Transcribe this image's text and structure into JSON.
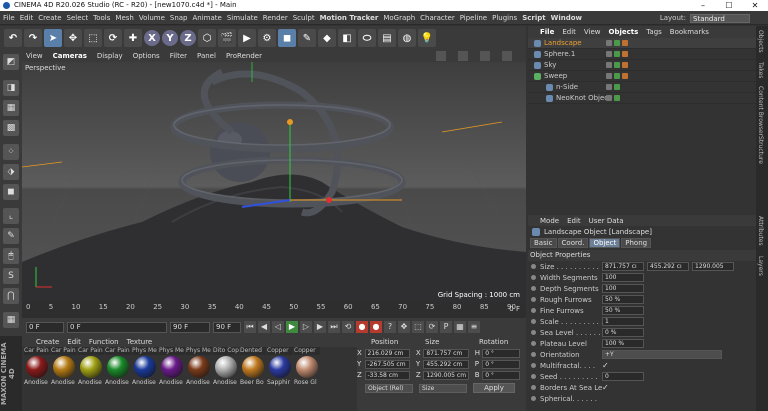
{
  "titlebar": {
    "title": "CINEMA 4D R20.026 Studio (RC - R20) - [new1070.c4d *] - Main"
  },
  "menubar": {
    "items": [
      "File",
      "Edit",
      "Create",
      "Select",
      "Tools",
      "Mesh",
      "Volume",
      "Snap",
      "Animate",
      "Simulate",
      "Render",
      "Sculpt",
      "Motion Tracker",
      "MoGraph",
      "Character",
      "Pipeline",
      "Plugins",
      "Script",
      "Window"
    ],
    "layout_label": "Layout:",
    "layout_value": "Standard"
  },
  "toolbar": {
    "axis_x": "X",
    "axis_y": "Y",
    "axis_z": "Z"
  },
  "viewport": {
    "menu": [
      "View",
      "Cameras",
      "Display",
      "Options",
      "Filter",
      "Panel",
      "ProRender"
    ],
    "label": "Perspective",
    "grid_spacing": "Grid Spacing : 1000 cm"
  },
  "timeline": {
    "ticks": [
      "0",
      "5",
      "10",
      "15",
      "20",
      "25",
      "30",
      "35",
      "40",
      "45",
      "50",
      "55",
      "60",
      "65",
      "70",
      "75",
      "80",
      "85",
      "90"
    ],
    "end_label": "0 F",
    "start_frame": "0 F",
    "cur_frame": "0 F",
    "end_frame": "90 F",
    "max_frame": "90 F"
  },
  "materials": {
    "menu": [
      "Create",
      "Edit",
      "Function",
      "Texture"
    ],
    "brand": "MAXON CINEMA 4D",
    "items": [
      {
        "top": "Car Pain",
        "name": "Anodise",
        "color": "#8a1a1a"
      },
      {
        "top": "Car Pain",
        "name": "Anodise",
        "color": "#b57b14"
      },
      {
        "top": "Car Pain",
        "name": "Anodise",
        "color": "#a0a014"
      },
      {
        "top": "Car Pain",
        "name": "Anodise",
        "color": "#1a8a2a"
      },
      {
        "top": "Phys Me",
        "name": "Anodise",
        "color": "#1a3a9a"
      },
      {
        "top": "Phys Me",
        "name": "Anodise",
        "color": "#6a1a8a"
      },
      {
        "top": "Phys Me",
        "name": "Anodise",
        "color": "#7a3a1a"
      },
      {
        "top": "Dito Cop",
        "name": "Anodise",
        "color": "#b0b0b0"
      },
      {
        "top": "Dented",
        "name": "Beer Bo",
        "color": "#c07a20"
      },
      {
        "top": "Copper",
        "name": "Sapphir",
        "color": "#2a3aa0"
      },
      {
        "top": "Copper",
        "name": "Rose Gl",
        "color": "#c08a70"
      }
    ]
  },
  "coords": {
    "headers": [
      "Position",
      "Size",
      "Rotation"
    ],
    "rows": [
      {
        "axis": "X",
        "pos": "216.029 cm",
        "size": "871.757 cm",
        "rot_axis": "H",
        "rot": "0 °"
      },
      {
        "axis": "Y",
        "pos": "-267.505 cm",
        "size": "455.292 cm",
        "rot_axis": "P",
        "rot": "0 °"
      },
      {
        "axis": "Z",
        "pos": "-33.58 cm",
        "size": "1290.005 cm",
        "rot_axis": "B",
        "rot": "0 °"
      }
    ],
    "mode1": "Object (Rel)",
    "mode2": "Size",
    "apply": "Apply"
  },
  "objects": {
    "menu": [
      "File",
      "Edit",
      "View",
      "Objects",
      "Tags",
      "Bookmarks"
    ],
    "items": [
      {
        "name": "Landscape",
        "highlight": true,
        "icon": "#6a8ab0"
      },
      {
        "name": "Sphere.1",
        "highlight": false,
        "icon": "#6a8ab0"
      },
      {
        "name": "Sky",
        "highlight": false,
        "icon": "#6a8ab0"
      },
      {
        "name": "Sweep",
        "highlight": false,
        "icon": "#5ab060"
      },
      {
        "name": "n-Side",
        "highlight": false,
        "icon": "#6a8ab0"
      },
      {
        "name": "NeoKnot Object",
        "highlight": false,
        "icon": "#6a8ab0"
      }
    ]
  },
  "attributes": {
    "menu": [
      "Mode",
      "Edit",
      "User Data"
    ],
    "title": "Landscape Object [Landscape]",
    "tabs": [
      "Basic",
      "Coord.",
      "Object",
      "Phong"
    ],
    "section": "Object Properties",
    "props": [
      {
        "label": "Size . . . . . . . . . .",
        "v1": "871.757 cı",
        "v2": "455.292 cı",
        "v3": "1290.005"
      },
      {
        "label": "Width Segments",
        "v1": "100"
      },
      {
        "label": "Depth Segments",
        "v1": "100"
      },
      {
        "label": "Rough Furrows",
        "v1": "50 %"
      },
      {
        "label": "Fine Furrows",
        "v1": "50 %"
      },
      {
        "label": "Scale . . . . . . . . . .",
        "v1": "1"
      },
      {
        "label": "Sea Level . . . . . .",
        "v1": "0 %"
      },
      {
        "label": "Plateau Level",
        "v1": "100 %"
      },
      {
        "label": "Orientation",
        "v1": "+Y",
        "wide": true
      },
      {
        "label": "Multifractal. . . .",
        "check": "✓"
      },
      {
        "label": "Seed . . . . . . . . .",
        "v1": "0"
      },
      {
        "label": "Borders At Sea Level",
        "check": "✓"
      },
      {
        "label": "Spherical. . . . . .",
        "check": ""
      }
    ]
  },
  "sidetabs": [
    "Objects",
    "Takes",
    "Content Browser",
    "Structure",
    "Attributes",
    "Layers"
  ]
}
